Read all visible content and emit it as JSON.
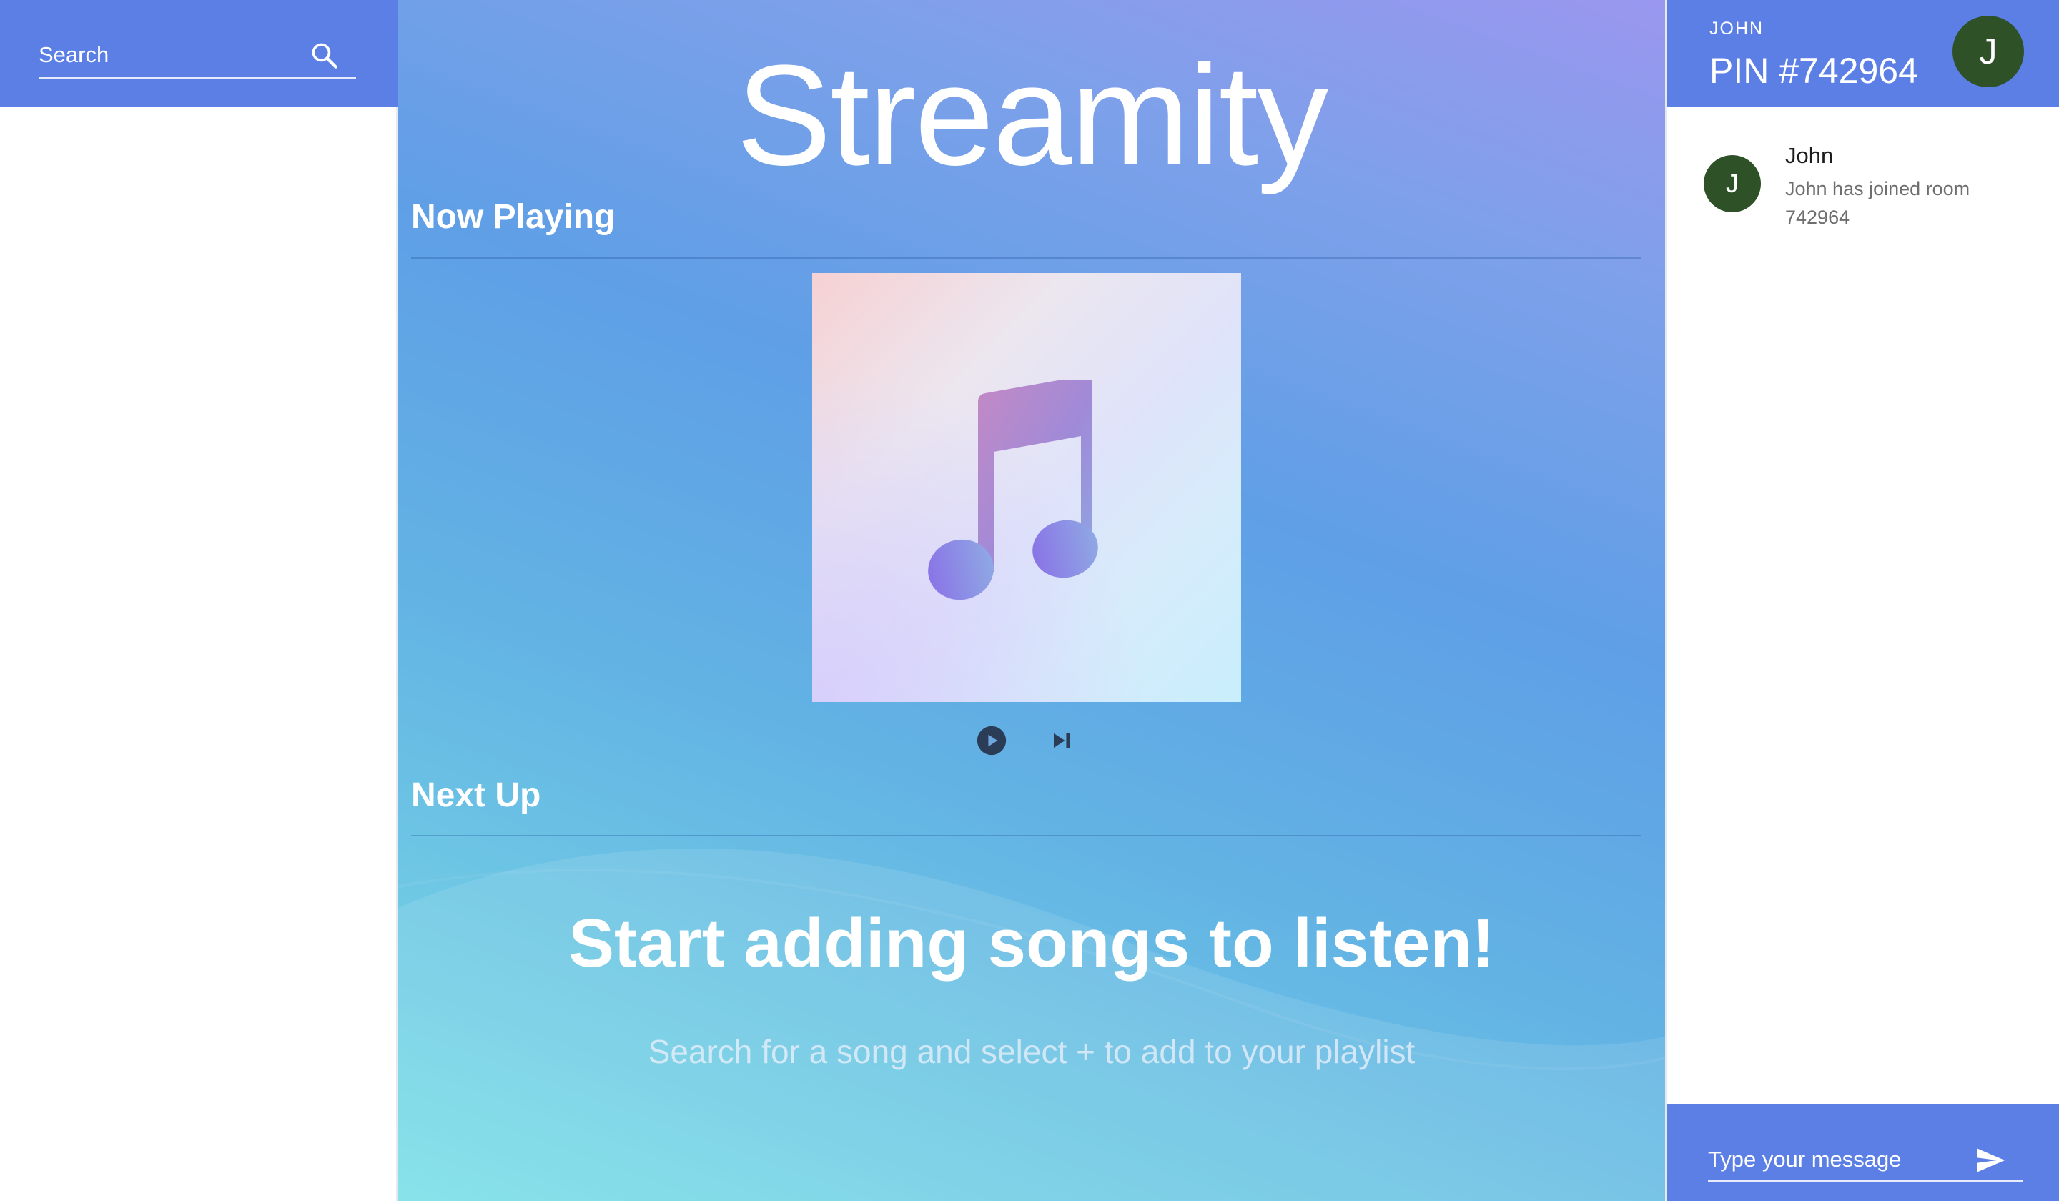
{
  "search": {
    "placeholder": "Search",
    "icon": "search-icon"
  },
  "brand": {
    "title": "Streamity"
  },
  "now_playing": {
    "heading": "Now Playing",
    "artwork_icon": "music-note-icon"
  },
  "controls": {
    "play_icon": "play-circle-icon",
    "skip_icon": "skip-next-icon"
  },
  "next_up": {
    "heading": "Next Up",
    "empty_title": "Start adding songs to listen!",
    "empty_subtitle": "Search for a song and select + to add to your playlist"
  },
  "user": {
    "name": "JOHN",
    "pin": "PIN #742964",
    "avatar_initial": "J"
  },
  "chat": {
    "messages": [
      {
        "avatar_initial": "J",
        "sender": "John",
        "text": "John has joined room 742964"
      }
    ],
    "input_placeholder": "Type your message",
    "send_icon": "send-icon"
  },
  "colors": {
    "accent": "#5b7fe5",
    "avatar": "#2e5128",
    "gradient_top": "#9a97ef",
    "gradient_bottom": "#7be0e8"
  }
}
